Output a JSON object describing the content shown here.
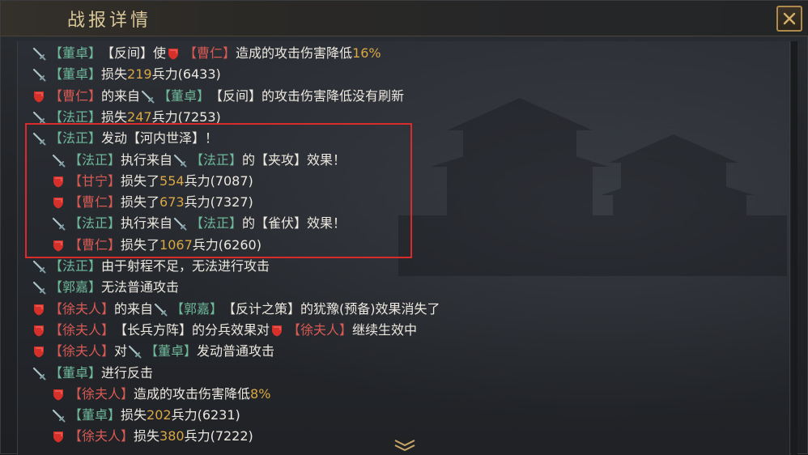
{
  "window": {
    "title": "战报详情"
  },
  "icons": {
    "sword": "sword-icon",
    "shield": "shield-icon",
    "close": "close-icon",
    "more": "chevron-down-icon"
  },
  "colors": {
    "ally_name": "#6fb89a",
    "enemy_name": "#d85a55",
    "number": "#d9a845",
    "highlight": "#d92b2b"
  },
  "log": [
    {
      "icon": "sword",
      "parts": [
        [
          "g",
          "【董卓】"
        ],
        [
          "t",
          "【反间】使"
        ],
        [
          "shield",
          ""
        ],
        [
          "r",
          "【曹仁】"
        ],
        [
          "t",
          "造成的攻击伤害降低"
        ],
        [
          "n",
          "16%"
        ]
      ]
    },
    {
      "icon": "sword",
      "parts": [
        [
          "g",
          "【董卓】"
        ],
        [
          "t",
          "损失"
        ],
        [
          "n",
          "219"
        ],
        [
          "t",
          "兵力(6433)"
        ]
      ]
    },
    {
      "icon": "shield",
      "parts": [
        [
          "r",
          "【曹仁】"
        ],
        [
          "t",
          "的来自"
        ],
        [
          "sword",
          ""
        ],
        [
          "g",
          "【董卓】"
        ],
        [
          "t",
          "【反间】的攻击伤害降低没有刷新"
        ]
      ]
    },
    {
      "icon": "sword",
      "parts": [
        [
          "g",
          "【法正】"
        ],
        [
          "t",
          "损失"
        ],
        [
          "n",
          "247"
        ],
        [
          "t",
          "兵力(7253)"
        ]
      ]
    },
    {
      "icon": "sword",
      "parts": [
        [
          "g",
          "【法正】"
        ],
        [
          "t",
          "发动【河内世泽】！"
        ]
      ]
    },
    {
      "icon": "sword",
      "indent": true,
      "parts": [
        [
          "g",
          "【法正】"
        ],
        [
          "t",
          "执行来自"
        ],
        [
          "sword",
          ""
        ],
        [
          "g",
          "【法正】"
        ],
        [
          "t",
          "的【夹攻】效果！"
        ]
      ]
    },
    {
      "icon": "shield",
      "indent": true,
      "parts": [
        [
          "r",
          "【甘宁】"
        ],
        [
          "t",
          "损失了"
        ],
        [
          "n",
          "554"
        ],
        [
          "t",
          "兵力(7087)"
        ]
      ]
    },
    {
      "icon": "shield",
      "indent": true,
      "parts": [
        [
          "r",
          "【曹仁】"
        ],
        [
          "t",
          "损失了"
        ],
        [
          "n",
          "673"
        ],
        [
          "t",
          "兵力(7327)"
        ]
      ]
    },
    {
      "icon": "sword",
      "indent": true,
      "parts": [
        [
          "g",
          "【法正】"
        ],
        [
          "t",
          "执行来自"
        ],
        [
          "sword",
          ""
        ],
        [
          "g",
          "【法正】"
        ],
        [
          "t",
          "的【雀伏】效果！"
        ]
      ]
    },
    {
      "icon": "shield",
      "indent": true,
      "parts": [
        [
          "r",
          "【曹仁】"
        ],
        [
          "t",
          "损失了"
        ],
        [
          "n",
          "1067"
        ],
        [
          "t",
          "兵力(6260)"
        ]
      ]
    },
    {
      "icon": "sword",
      "parts": [
        [
          "g",
          "【法正】"
        ],
        [
          "t",
          "由于射程不足，无法进行攻击"
        ]
      ]
    },
    {
      "icon": "sword",
      "parts": [
        [
          "g",
          "【郭嘉】"
        ],
        [
          "t",
          "无法普通攻击"
        ]
      ]
    },
    {
      "icon": "shield",
      "parts": [
        [
          "r",
          "【徐夫人】"
        ],
        [
          "t",
          "的来自"
        ],
        [
          "sword",
          ""
        ],
        [
          "g",
          "【郭嘉】"
        ],
        [
          "t",
          "【反计之策】的犹豫(预备)效果消失了"
        ]
      ]
    },
    {
      "icon": "shield",
      "parts": [
        [
          "r",
          "【徐夫人】"
        ],
        [
          "t",
          "【长兵方阵】的分兵效果对"
        ],
        [
          "shield",
          ""
        ],
        [
          "r",
          "【徐夫人】"
        ],
        [
          "t",
          "继续生效中"
        ]
      ]
    },
    {
      "icon": "shield",
      "parts": [
        [
          "r",
          "【徐夫人】"
        ],
        [
          "t",
          "对"
        ],
        [
          "sword",
          ""
        ],
        [
          "g",
          "【董卓】"
        ],
        [
          "t",
          "发动普通攻击"
        ]
      ]
    },
    {
      "icon": "sword",
      "parts": [
        [
          "g",
          "【董卓】"
        ],
        [
          "t",
          "进行反击"
        ]
      ]
    },
    {
      "icon": "shield",
      "indent": true,
      "parts": [
        [
          "r",
          "【徐夫人】"
        ],
        [
          "t",
          "造成的攻击伤害降低"
        ],
        [
          "n",
          "8%"
        ]
      ]
    },
    {
      "icon": "sword",
      "indent": true,
      "parts": [
        [
          "g",
          "【董卓】"
        ],
        [
          "t",
          "损失"
        ],
        [
          "n",
          "202"
        ],
        [
          "t",
          "兵力(6231)"
        ]
      ]
    },
    {
      "icon": "shield",
      "indent": true,
      "parts": [
        [
          "r",
          "【徐夫人】"
        ],
        [
          "t",
          "损失"
        ],
        [
          "n",
          "380"
        ],
        [
          "t",
          "兵力(7222)"
        ]
      ]
    }
  ]
}
